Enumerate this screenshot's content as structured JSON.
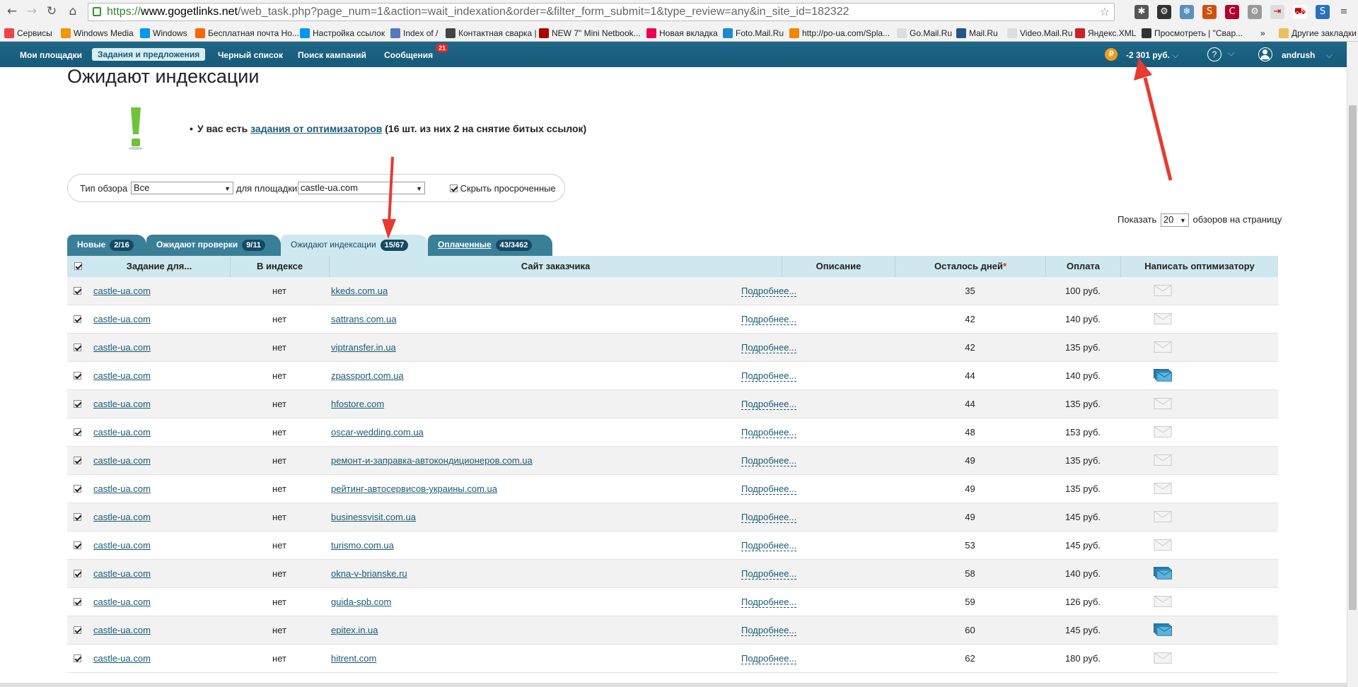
{
  "browser": {
    "url_scheme": "https://",
    "url_host": "www.gogetlinks.net",
    "url_path": "/web_task.php?page_num=1&action=wait_indexation&order=&filter_form_submit=1&type_review=any&in_site_id=182322",
    "bookmarks": [
      "Сервисы",
      "Windows Media",
      "Windows",
      "Бесплатная почта Но...",
      "Настройка ссылок",
      "Index of /",
      "Контактная сварка |",
      "NEW 7\" Mini Netbook...",
      "Новая вкладка",
      "Foto.Mail.Ru",
      "http://po-ua.com/Spla...",
      "Go.Mail.Ru",
      "Mail.Ru",
      "Video.Mail.Ru",
      "Яндекс.XML",
      "Просмотреть | \"Свар..."
    ],
    "bookmarks_more": "»",
    "other_bookmarks": "Другие закладки"
  },
  "nav": {
    "items": [
      "Мои площадки",
      "Задания и предложения",
      "Черный список",
      "Поиск кампаний",
      "Сообщения"
    ],
    "messages_badge": "21",
    "balance": "-2 301 руб.",
    "user": "andrush",
    "help": "?"
  },
  "page": {
    "title": "Ожидают индексации",
    "notice_prefix": "У вас есть ",
    "notice_link": "задания от оптимизаторов",
    "notice_suffix": " (16 шт. из них 2 на снятие битых ссылок)"
  },
  "filter": {
    "review_type_label": "Тип обзора",
    "review_type_value": "Все",
    "site_label": "для площадки",
    "site_value": "castle-ua.com",
    "hide_expired_label": "Скрыть просроченные"
  },
  "perpage": {
    "prefix": "Показать",
    "value": "20",
    "suffix": "обзоров на страницу"
  },
  "tabs": [
    {
      "label": "Новые",
      "count": "2/16"
    },
    {
      "label": "Ожидают проверки",
      "count": "9/11"
    },
    {
      "label": "Ожидают индексации",
      "count": "15/67"
    },
    {
      "label": "Оплаченные",
      "count": "43/3462"
    }
  ],
  "table": {
    "headers": [
      "Задание для...",
      "В индексе",
      "Сайт заказчика",
      "Описание",
      "Осталось дней",
      "Оплата",
      "Написать оптимизатору"
    ],
    "required_mark": "*",
    "rows": [
      {
        "task": "castle-ua.com",
        "index": "нет",
        "site": "kkeds.com.ua",
        "desc": "Подробнее...",
        "days": "35",
        "pay": "100 руб.",
        "msg": "plain"
      },
      {
        "task": "castle-ua.com",
        "index": "нет",
        "site": "sattrans.com.ua",
        "desc": "Подробнее...",
        "days": "42",
        "pay": "140 руб.",
        "msg": "plain"
      },
      {
        "task": "castle-ua.com",
        "index": "нет",
        "site": "viptransfer.in.ua",
        "desc": "Подробнее...",
        "days": "42",
        "pay": "135 руб.",
        "msg": "plain"
      },
      {
        "task": "castle-ua.com",
        "index": "нет",
        "site": "zpassport.com.ua",
        "desc": "Подробнее...",
        "days": "44",
        "pay": "140 руб.",
        "msg": "stack"
      },
      {
        "task": "castle-ua.com",
        "index": "нет",
        "site": "hfostore.com",
        "desc": "Подробнее...",
        "days": "44",
        "pay": "135 руб.",
        "msg": "plain"
      },
      {
        "task": "castle-ua.com",
        "index": "нет",
        "site": "oscar-wedding.com.ua",
        "desc": "Подробнее...",
        "days": "48",
        "pay": "153 руб.",
        "msg": "plain"
      },
      {
        "task": "castle-ua.com",
        "index": "нет",
        "site": "ремонт-и-заправка-автокондиционеров.com.ua",
        "desc": "Подробнее...",
        "days": "49",
        "pay": "135 руб.",
        "msg": "plain"
      },
      {
        "task": "castle-ua.com",
        "index": "нет",
        "site": "рейтинг-автосервисов-украины.com.ua",
        "desc": "Подробнее...",
        "days": "49",
        "pay": "135 руб.",
        "msg": "plain"
      },
      {
        "task": "castle-ua.com",
        "index": "нет",
        "site": "businessvisit.com.ua",
        "desc": "Подробнее...",
        "days": "49",
        "pay": "145 руб.",
        "msg": "plain"
      },
      {
        "task": "castle-ua.com",
        "index": "нет",
        "site": "turismo.com.ua",
        "desc": "Подробнее...",
        "days": "53",
        "pay": "145 руб.",
        "msg": "plain"
      },
      {
        "task": "castle-ua.com",
        "index": "нет",
        "site": "okna-v-brianske.ru",
        "desc": "Подробнее...",
        "days": "58",
        "pay": "140 руб.",
        "msg": "stack"
      },
      {
        "task": "castle-ua.com",
        "index": "нет",
        "site": "guida-spb.com",
        "desc": "Подробнее...",
        "days": "59",
        "pay": "126 руб.",
        "msg": "plain"
      },
      {
        "task": "castle-ua.com",
        "index": "нет",
        "site": "epitex.in.ua",
        "desc": "Подробнее...",
        "days": "60",
        "pay": "145 руб.",
        "msg": "stack"
      },
      {
        "task": "castle-ua.com",
        "index": "нет",
        "site": "hitrent.com",
        "desc": "Подробнее...",
        "days": "62",
        "pay": "180 руб.",
        "msg": "plain"
      }
    ]
  }
}
